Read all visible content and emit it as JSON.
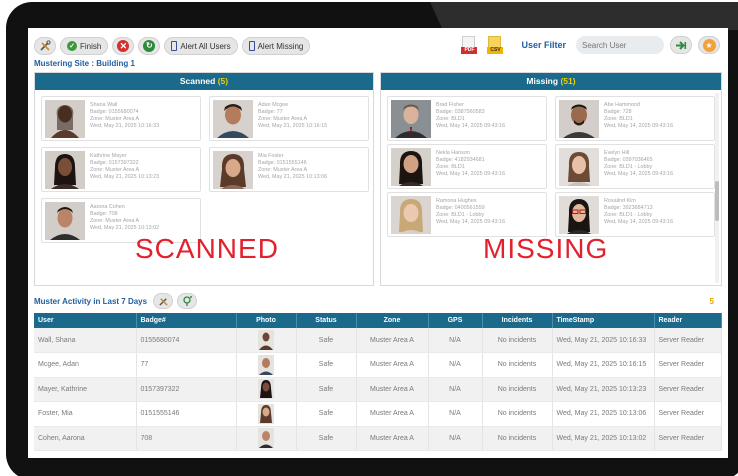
{
  "toolbar": {
    "tools_icon": "tools-icon",
    "finish_label": "Finish",
    "alert_all_label": "Alert All Users",
    "alert_missing_label": "Alert Missing",
    "pdf_tag": "PDF",
    "csv_tag": "CSV",
    "user_filter_label": "User Filter",
    "search_placeholder": "Search User"
  },
  "site_title": "Mustering Site : Building 1",
  "scanned": {
    "title": "Scanned",
    "count": "(5)",
    "big_label": "SCANNED",
    "cards": [
      {
        "name": "Shana Wall",
        "badge": "Badge: 0155680074",
        "zone": "Zone: Muster Area A",
        "time": "Wed, May 21, 2025 10:16:33"
      },
      {
        "name": "Adan Mcgee",
        "badge": "Badge: 77",
        "zone": "Zone: Muster Area A",
        "time": "Wed, May 21, 2025 10:16:15"
      },
      {
        "name": "Kathrine Mayer",
        "badge": "Badge: 0157397322",
        "zone": "Zone: Muster Area A",
        "time": "Wed, May 21, 2025 10:13:23"
      },
      {
        "name": "Mia Foster",
        "badge": "Badge: 0151555146",
        "zone": "Zone: Muster Area A",
        "time": "Wed, May 21, 2025 10:13:06"
      },
      {
        "name": "Aarona Cohen",
        "badge": "Badge: 708",
        "zone": "Zone: Muster Area A",
        "time": "Wed, May 21, 2025 10:13:02"
      }
    ]
  },
  "missing": {
    "title": "Missing",
    "count": "(51)",
    "big_label": "MISSING",
    "cards": [
      {
        "name": "Brad Fisher",
        "badge": "Badge: 0387560583",
        "zone": "Zone: BLD1",
        "time": "Wed, May 14, 2025 09:43:16"
      },
      {
        "name": "Abe Hammond",
        "badge": "Badge: 728",
        "zone": "Zone: BLD1",
        "time": "Wed, May 14, 2025 09:43:16"
      },
      {
        "name": "Nekla Hanson",
        "badge": "Badge: 4182934681",
        "zone": "Zone: BLD1",
        "time": "Wed, May 14, 2025 09:43:16"
      },
      {
        "name": "Evelyn Hill",
        "badge": "Badge: 0397036465",
        "zone": "Zone: BLD1 - Lobby",
        "time": "Wed, May 14, 2025 09:43:16"
      },
      {
        "name": "Ramona Hughes",
        "badge": "Badge: 0400561559",
        "zone": "Zone: BLD1 - Lobby",
        "time": "Wed, May 14, 2025 09:43:16"
      },
      {
        "name": "Rosalind Kim",
        "badge": "Badge: 3923684713",
        "zone": "Zone: BLD1 - Lobby",
        "time": "Wed, May 14, 2025 09:43:16"
      }
    ]
  },
  "activity": {
    "title": "Muster Activity in Last 7 Days",
    "count": "5",
    "columns": [
      "User",
      "Badge#",
      "Photo",
      "Status",
      "Zone",
      "GPS",
      "Incidents",
      "TimeStamp",
      "Reader"
    ],
    "rows": [
      {
        "user": "Wall, Shana",
        "badge": "0155680074",
        "status": "Safe",
        "zone": "Muster Area A",
        "gps": "N/A",
        "incidents": "No incidents",
        "timestamp": "Wed, May 21, 2025 10:16:33",
        "reader": "Server Reader"
      },
      {
        "user": "Mcgee, Adan",
        "badge": "77",
        "status": "Safe",
        "zone": "Muster Area A",
        "gps": "N/A",
        "incidents": "No incidents",
        "timestamp": "Wed, May 21, 2025 10:16:15",
        "reader": "Server Reader"
      },
      {
        "user": "Mayer, Kathrine",
        "badge": "0157397322",
        "status": "Safe",
        "zone": "Muster Area A",
        "gps": "N/A",
        "incidents": "No incidents",
        "timestamp": "Wed, May 21, 2025 10:13:23",
        "reader": "Server Reader"
      },
      {
        "user": "Foster, Mia",
        "badge": "0151555146",
        "status": "Safe",
        "zone": "Muster Area A",
        "gps": "N/A",
        "incidents": "No incidents",
        "timestamp": "Wed, May 21, 2025 10:13:06",
        "reader": "Server Reader"
      },
      {
        "user": "Cohen, Aarona",
        "badge": "708",
        "status": "Safe",
        "zone": "Muster Area A",
        "gps": "N/A",
        "incidents": "No incidents",
        "timestamp": "Wed, May 21, 2025 10:13:02",
        "reader": "Server Reader"
      }
    ]
  },
  "colors": {
    "header_bg": "#1b6a8c",
    "accent_blue": "#1f5e9e",
    "count_yellow": "#f0d000",
    "big_label_red": "#e3202d"
  }
}
